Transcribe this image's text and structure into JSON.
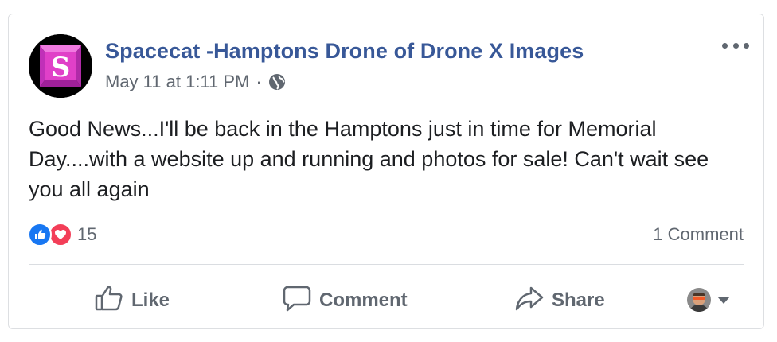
{
  "post": {
    "author": "Spacecat -Hamptons Drone of Drone X Images",
    "timestamp": "May 11 at 1:11 PM",
    "separator": "·",
    "privacy_icon": "globe-icon",
    "body": "Good News...I'll be back in the Hamptons just in time for Memorial Day....with a website up and running and photos for sale! Can't wait see you all again",
    "avatar_letter": "S"
  },
  "reactions": {
    "types": [
      "like",
      "love"
    ],
    "count": "15"
  },
  "comments": {
    "count_label": "1 Comment"
  },
  "actions": {
    "like": "Like",
    "comment": "Comment",
    "share": "Share"
  },
  "colors": {
    "author_link": "#385898",
    "like_blue": "#1877f2",
    "love_red": "#f33e58",
    "muted_text": "#606770",
    "avatar_magenta": "#e040c8"
  }
}
